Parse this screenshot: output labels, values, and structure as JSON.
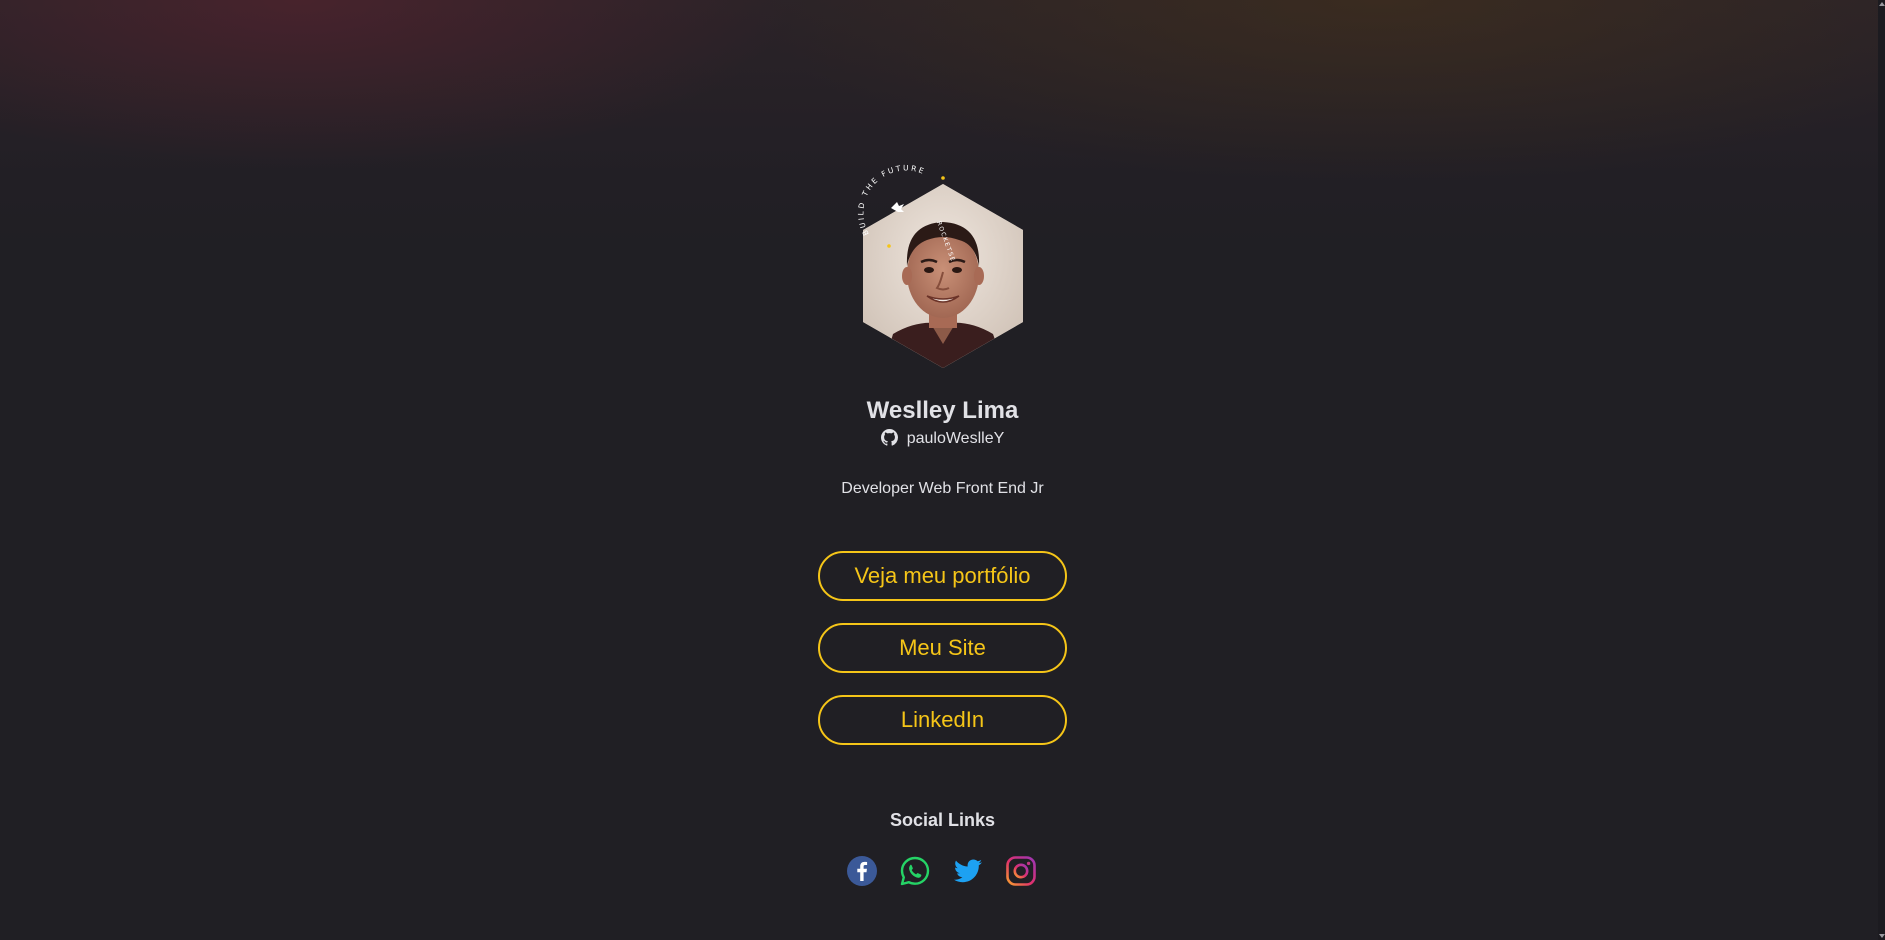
{
  "profile": {
    "name": "Weslley Lima",
    "github_username": "pauloWeslleY",
    "bio": "Developer Web Front End Jr",
    "badge_text": "BUILD THE FUTURE ROCKETSEAT"
  },
  "links": [
    {
      "label": "Veja meu portfólio"
    },
    {
      "label": "Meu Site"
    },
    {
      "label": "LinkedIn"
    }
  ],
  "social": {
    "title": "Social Links",
    "icons": [
      "facebook-icon",
      "whatsapp-icon",
      "twitter-icon",
      "instagram-icon"
    ]
  },
  "colors": {
    "background": "#201f24",
    "text": "#e1e1e6",
    "accent": "#f5c518",
    "facebook": "#3b5998",
    "whatsapp": "#25d366",
    "twitter": "#1da1f2",
    "instagram": "#e1306c"
  }
}
